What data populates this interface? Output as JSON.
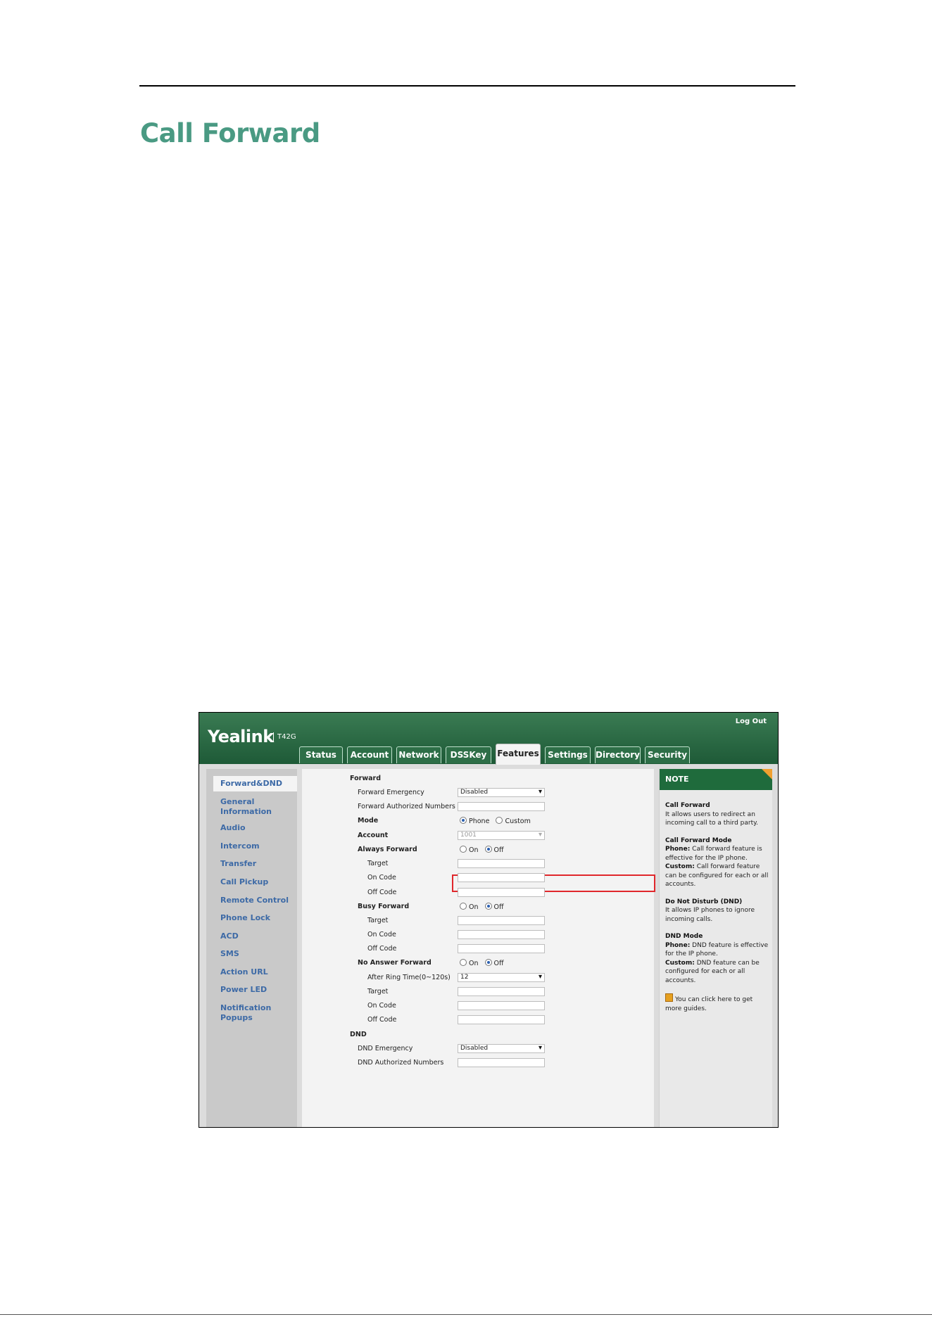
{
  "page": {
    "title": "Call Forward"
  },
  "screenshot": {
    "logo": "Yealink",
    "model": "T42G",
    "logout": "Log Out",
    "tabs": [
      "Status",
      "Account",
      "Network",
      "DSSKey",
      "Features",
      "Settings",
      "Directory",
      "Security"
    ],
    "active_tab": "Features",
    "nav": [
      "Forward&DND",
      "General Information",
      "Audio",
      "Intercom",
      "Transfer",
      "Call Pickup",
      "Remote Control",
      "Phone Lock",
      "ACD",
      "SMS",
      "Action URL",
      "Power LED",
      "Notification Popups"
    ],
    "form": {
      "forward_section": "Forward",
      "forward_emergency": {
        "label": "Forward Emergency",
        "value": "Disabled"
      },
      "forward_authorized": {
        "label": "Forward Authorized Numbers",
        "value": ""
      },
      "mode": {
        "label": "Mode",
        "options": [
          "Phone",
          "Custom"
        ],
        "selected": "Phone"
      },
      "account": {
        "label": "Account",
        "value": "1001"
      },
      "always_forward": {
        "label": "Always Forward",
        "on": "On",
        "off": "Off",
        "selected": "Off"
      },
      "busy_forward": {
        "label": "Busy Forward",
        "on": "On",
        "off": "Off",
        "selected": "Off"
      },
      "no_answer_forward": {
        "label": "No Answer Forward",
        "on": "On",
        "off": "Off",
        "selected": "Off"
      },
      "target_label": "Target",
      "on_code_label": "On Code",
      "off_code_label": "Off Code",
      "after_ring_time": {
        "label": "After Ring Time(0~120s)",
        "value": "12"
      },
      "dnd_section": "DND",
      "dnd_emergency": {
        "label": "DND Emergency",
        "value": "Disabled"
      },
      "dnd_authorized": {
        "label": "DND Authorized Numbers",
        "value": ""
      }
    },
    "note": {
      "header": "NOTE",
      "call_forward_title": "Call Forward",
      "call_forward_text": "It allows users to redirect an incoming call to a third party.",
      "cf_mode_title": "Call Forward Mode",
      "cf_phone_label": "Phone:",
      "cf_phone_text": " Call forward feature is effective for the IP phone.",
      "cf_custom_label": "Custom:",
      "cf_custom_text": " Call forward feature can be configured for each or all accounts.",
      "dnd_title": "Do Not Disturb (DND)",
      "dnd_text": "It allows IP phones to ignore incoming calls.",
      "dnd_mode_title": "DND Mode",
      "dnd_phone_label": "Phone:",
      "dnd_phone_text": " DND feature is effective for the IP phone.",
      "dnd_custom_label": "Custom:",
      "dnd_custom_text": " DND feature can be configured for each or all accounts.",
      "guide_text": "You can click here to get more guides."
    }
  }
}
